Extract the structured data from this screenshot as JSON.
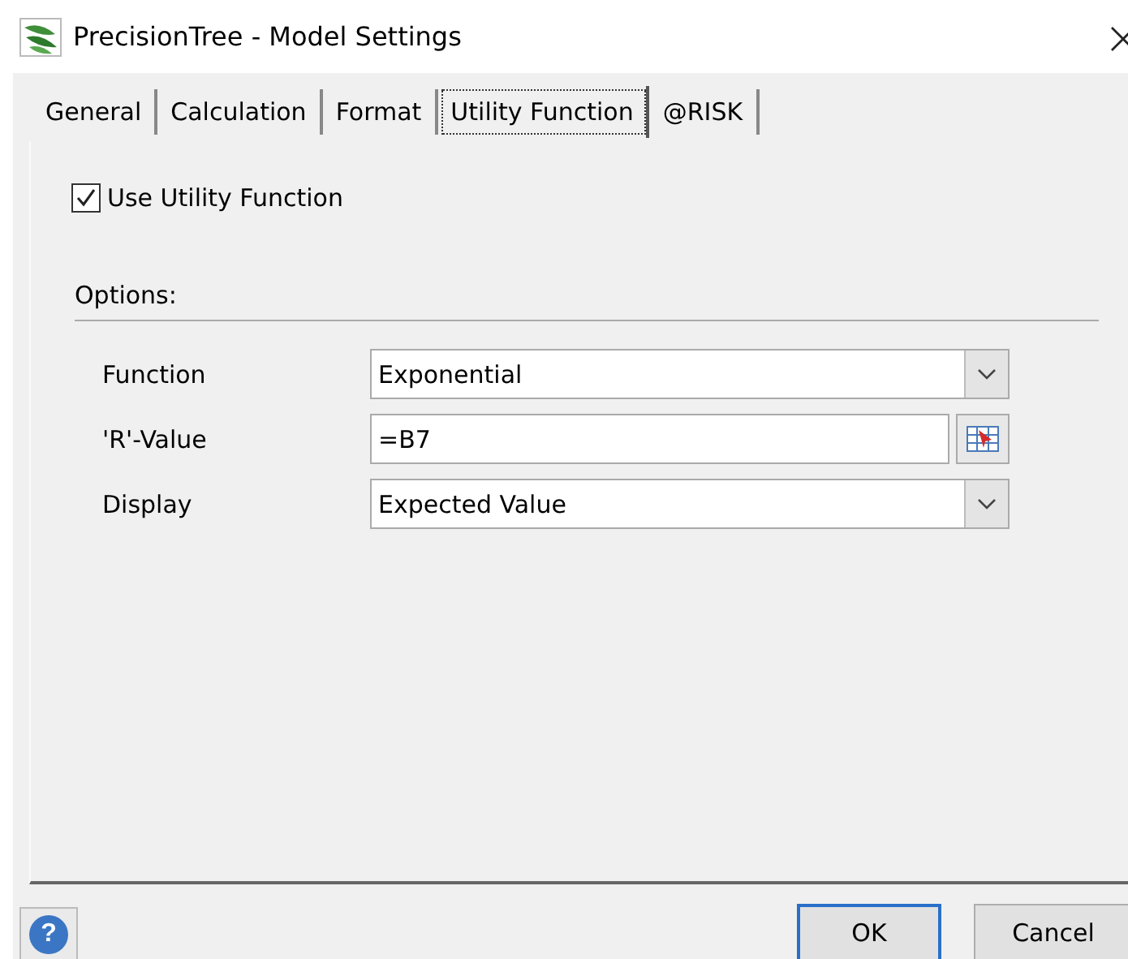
{
  "window": {
    "title": "PrecisionTree - Model Settings"
  },
  "tabs": [
    {
      "label": "General",
      "selected": false
    },
    {
      "label": "Calculation",
      "selected": false
    },
    {
      "label": "Format",
      "selected": false
    },
    {
      "label": "Utility Function",
      "selected": true
    },
    {
      "label": "@RISK",
      "selected": false
    }
  ],
  "use_utility_function": {
    "label": "Use Utility Function",
    "checked": true
  },
  "options": {
    "heading": "Options:",
    "fields": [
      {
        "kind": "dropdown",
        "label": "Function",
        "value": "Exponential"
      },
      {
        "kind": "reference",
        "label": "'R'-Value",
        "value": "=B7"
      },
      {
        "kind": "dropdown",
        "label": "Display",
        "value": "Expected Value"
      }
    ]
  },
  "help": "?",
  "buttons": [
    {
      "label": "OK",
      "default": true
    },
    {
      "label": "Cancel",
      "default": false
    }
  ]
}
